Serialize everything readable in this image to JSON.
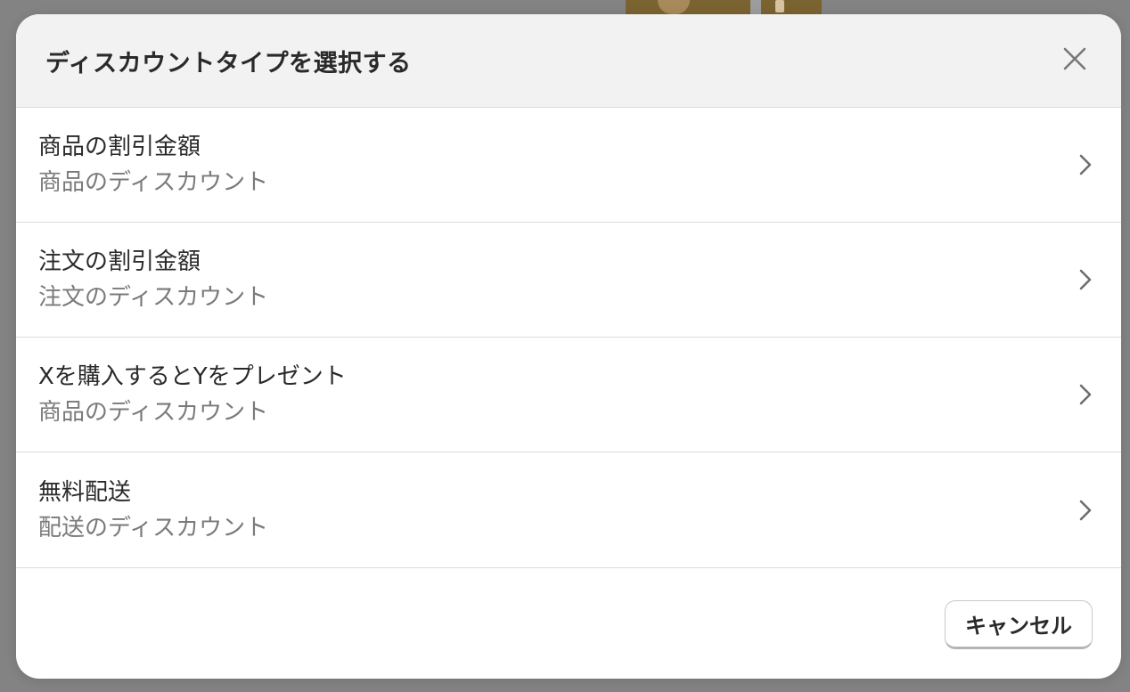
{
  "modal": {
    "title": "ディスカウントタイプを選択する",
    "close_icon": "close-icon",
    "options": [
      {
        "title": "商品の割引金額",
        "subtitle": "商品のディスカウント",
        "icon": "chevron-right-icon"
      },
      {
        "title": "注文の割引金額",
        "subtitle": "注文のディスカウント",
        "icon": "chevron-right-icon"
      },
      {
        "title": "Xを購入するとYをプレゼント",
        "subtitle": "商品のディスカウント",
        "icon": "chevron-right-icon"
      },
      {
        "title": "無料配送",
        "subtitle": "配送のディスカウント",
        "icon": "chevron-right-icon"
      }
    ],
    "footer": {
      "cancel_label": "キャンセル"
    }
  },
  "colors": {
    "overlay": "#838383",
    "header_bg": "#f2f2f2",
    "divider": "#dcdcdc",
    "text_primary": "#2a2a2a",
    "text_secondary": "#7a7a7a"
  }
}
